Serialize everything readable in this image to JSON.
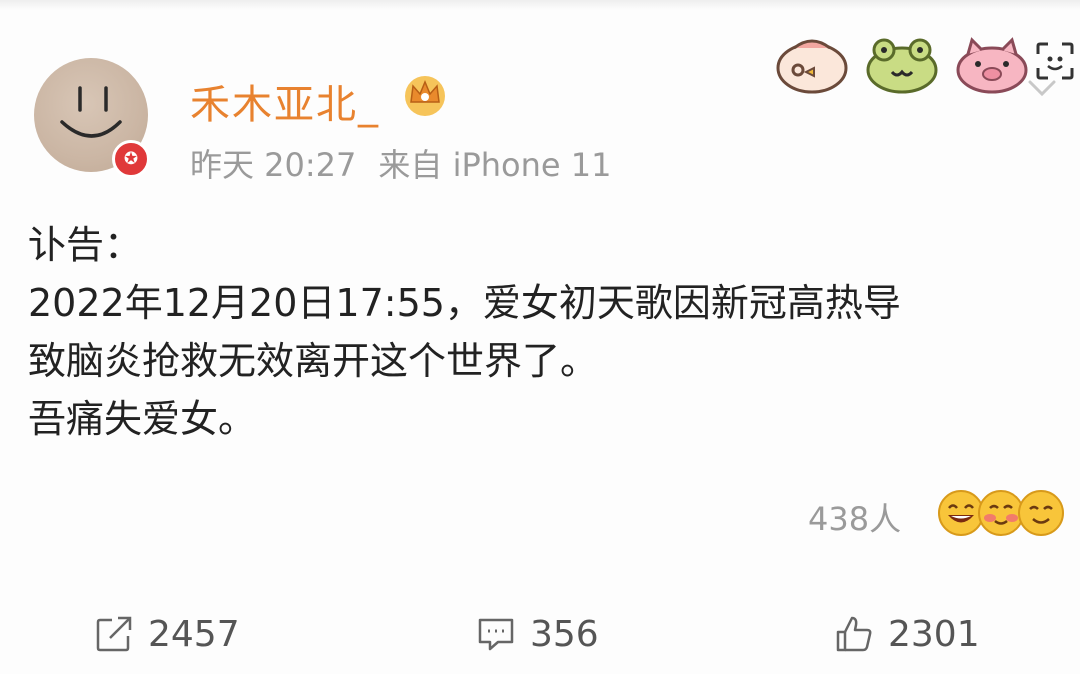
{
  "header": {
    "username": "禾木亚北_",
    "timestamp": "昨天 20:27",
    "source": "来自 iPhone 11"
  },
  "post": {
    "lines": [
      "讣告：",
      "2022年12月20日17:55，爱女初天歌因新冠高热导",
      "致脑炎抢救无效离开这个世界了。",
      "吾痛失爱女。"
    ]
  },
  "reactions": {
    "count_text": "438人"
  },
  "actions": {
    "share_count": "2457",
    "comment_count": "356",
    "like_count": "2301"
  },
  "icons": {
    "avatar": "smiley-avatar",
    "vip": "vip-badge-icon",
    "crown": "crown-icon",
    "stickers": [
      "chick-sticker-icon",
      "frog-sticker-icon",
      "pig-sticker-icon"
    ],
    "scan": "scan-icon",
    "share": "share-icon",
    "comment": "comment-icon",
    "like": "thumbs-up-icon"
  },
  "colors": {
    "username": "#e8822f",
    "meta": "#9a9a9a",
    "text": "#222222",
    "vip": "#e0393a"
  }
}
